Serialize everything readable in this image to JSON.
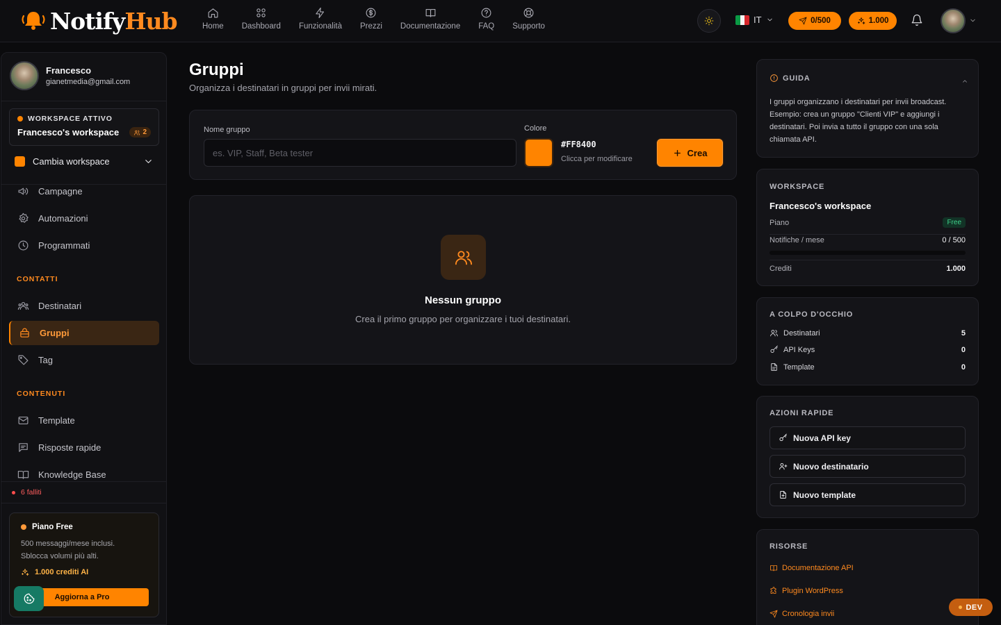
{
  "brand": {
    "name_part1": "Notify",
    "name_part2": "Hub"
  },
  "nav": [
    {
      "label": "Home",
      "icon": "home-icon"
    },
    {
      "label": "Dashboard",
      "icon": "grid-icon"
    },
    {
      "label": "Funzionalità",
      "icon": "lightning-icon"
    },
    {
      "label": "Prezzi",
      "icon": "dollar-icon"
    },
    {
      "label": "Documentazione",
      "icon": "book-icon"
    },
    {
      "label": "FAQ",
      "icon": "help-circle-icon"
    },
    {
      "label": "Supporto",
      "icon": "lifebuoy-icon"
    }
  ],
  "header": {
    "language": "IT",
    "notifications_pill": "0/500",
    "credits_pill": "1.000"
  },
  "user": {
    "name": "Francesco",
    "email": "gianetmedia@gmail.com"
  },
  "workspace": {
    "active_label": "WORKSPACE ATTIVO",
    "name": "Francesco's workspace",
    "members": "2",
    "switch_label": "Cambia workspace"
  },
  "sidebar": {
    "items_top": [
      {
        "label": "Campagne",
        "icon": "megaphone-icon"
      },
      {
        "label": "Automazioni",
        "icon": "cog-icon"
      },
      {
        "label": "Programmati",
        "icon": "clock-icon"
      }
    ],
    "section_contacts": "CONTATTI",
    "items_contacts": [
      {
        "label": "Destinatari",
        "icon": "users-icon"
      },
      {
        "label": "Gruppi",
        "icon": "bag-icon"
      },
      {
        "label": "Tag",
        "icon": "tag-icon"
      }
    ],
    "section_content": "CONTENUTI",
    "items_content": [
      {
        "label": "Template",
        "icon": "mail-icon"
      },
      {
        "label": "Risposte rapide",
        "icon": "message-icon"
      },
      {
        "label": "Knowledge Base",
        "icon": "book-open-icon"
      }
    ],
    "failed": "6 falliti"
  },
  "plan_card": {
    "title": "Piano Free",
    "desc_line1": "500 messaggi/mese inclusi.",
    "desc_line2": "Sblocca volumi più alti.",
    "credits": "1.000 crediti AI",
    "upgrade": "Aggiorna a Pro"
  },
  "page": {
    "title": "Gruppi",
    "subtitle": "Organizza i destinatari in gruppi per invii mirati."
  },
  "form": {
    "name_label": "Nome gruppo",
    "name_placeholder": "es. VIP, Staff, Beta tester",
    "name_value": "",
    "color_label": "Colore",
    "color_hex": "#FF8400",
    "color_hint": "Clicca per modificare",
    "create_label": "Crea"
  },
  "empty": {
    "title": "Nessun gruppo",
    "subtitle": "Crea il primo gruppo per organizzare i tuoi destinatari."
  },
  "guide": {
    "title": "GUIDA",
    "text": "I gruppi organizzano i destinatari per invii broadcast. Esempio: crea un gruppo \"Clienti VIP\" e aggiungi i destinatari. Poi invia a tutto il gruppo con una sola chiamata API."
  },
  "workspace_card": {
    "title": "WORKSPACE",
    "name": "Francesco's workspace",
    "plan_label": "Piano",
    "plan_value": "Free",
    "notif_label": "Notifiche / mese",
    "notif_value": "0 / 500",
    "notif_fraction": 0,
    "credits_label": "Crediti",
    "credits_value": "1.000"
  },
  "glance": {
    "title": "A COLPO D'OCCHIO",
    "rows": [
      {
        "label": "Destinatari",
        "value": "5",
        "icon": "user-icon"
      },
      {
        "label": "API Keys",
        "value": "0",
        "icon": "key-icon"
      },
      {
        "label": "Template",
        "value": "0",
        "icon": "file-icon"
      }
    ]
  },
  "quick_actions": {
    "title": "AZIONI RAPIDE",
    "items": [
      {
        "label": "Nuova API key",
        "icon": "key-icon"
      },
      {
        "label": "Nuovo destinatario",
        "icon": "user-plus-icon"
      },
      {
        "label": "Nuovo template",
        "icon": "file-plus-icon"
      }
    ]
  },
  "resources": {
    "title": "RISORSE",
    "items": [
      {
        "label": "Documentazione API",
        "icon": "book-icon"
      },
      {
        "label": "Plugin WordPress",
        "icon": "puzzle-icon"
      },
      {
        "label": "Cronologia invii",
        "icon": "send-icon"
      }
    ]
  },
  "dev_badge": "DEV",
  "colors": {
    "accent": "#ff8400",
    "bg": "#0b0b0d",
    "card": "#141418",
    "success": "#3fd28b",
    "danger": "#ff4d4d"
  }
}
